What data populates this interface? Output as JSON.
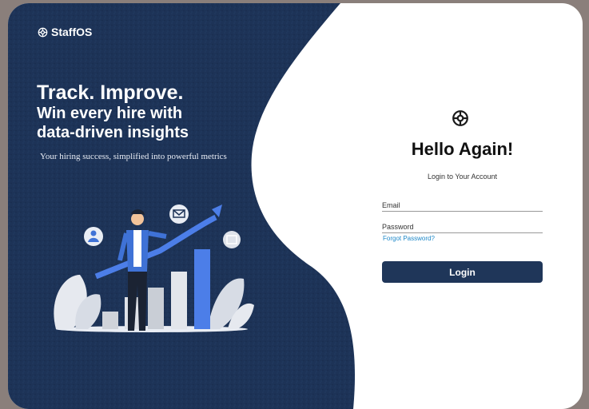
{
  "brand": {
    "name": "StaffOS",
    "icon": "staffos-logo-icon"
  },
  "hero": {
    "headline_line1": "Track. Improve.",
    "headline_line2": "Win every hire with",
    "headline_line3": "data-driven insights",
    "tagline": "Your hiring success, simplified into powerful metrics"
  },
  "login": {
    "title": "Hello Again!",
    "subtitle": "Login to Your Account",
    "email_placeholder": "Email",
    "password_placeholder": "Password",
    "forgot_label": "Forgot Password?",
    "button_label": "Login"
  },
  "colors": {
    "panel": "#1d3357",
    "accent": "#4c7ee8",
    "button": "#1f3659",
    "link": "#1e88c8"
  }
}
